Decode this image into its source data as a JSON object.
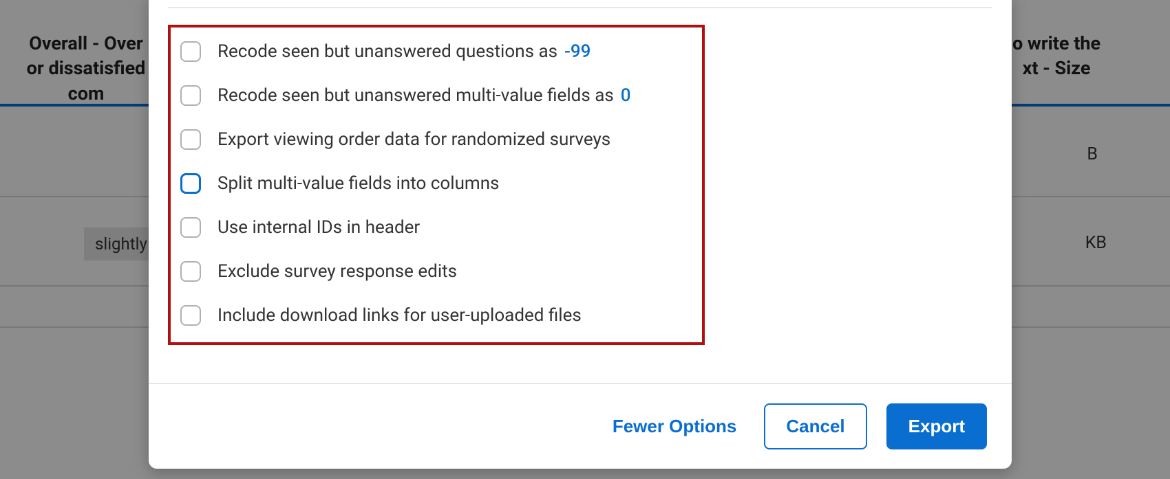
{
  "colors": {
    "accent": "#0a6ed1",
    "highlight_border": "#b30f12"
  },
  "background": {
    "header_left": "Overall - Over\nor dissatisfied\ncom",
    "header_right": "o write the\nxt - Size",
    "cell_b_1": "B",
    "cell_b_2": "KB",
    "chip": "slightly"
  },
  "options": [
    {
      "label": "Recode seen but unanswered questions as",
      "value": "-99",
      "checked": false,
      "focused": false
    },
    {
      "label": "Recode seen but unanswered multi-value fields as",
      "value": "0",
      "checked": false,
      "focused": false
    },
    {
      "label": "Export viewing order data for randomized surveys",
      "value": null,
      "checked": false,
      "focused": false
    },
    {
      "label": "Split multi-value fields into columns",
      "value": null,
      "checked": false,
      "focused": true
    },
    {
      "label": "Use internal IDs in header",
      "value": null,
      "checked": false,
      "focused": false
    },
    {
      "label": "Exclude survey response edits",
      "value": null,
      "checked": false,
      "focused": false
    },
    {
      "label": "Include download links for user-uploaded files",
      "value": null,
      "checked": false,
      "focused": false
    }
  ],
  "footer": {
    "fewer_options": "Fewer Options",
    "cancel": "Cancel",
    "export": "Export"
  }
}
